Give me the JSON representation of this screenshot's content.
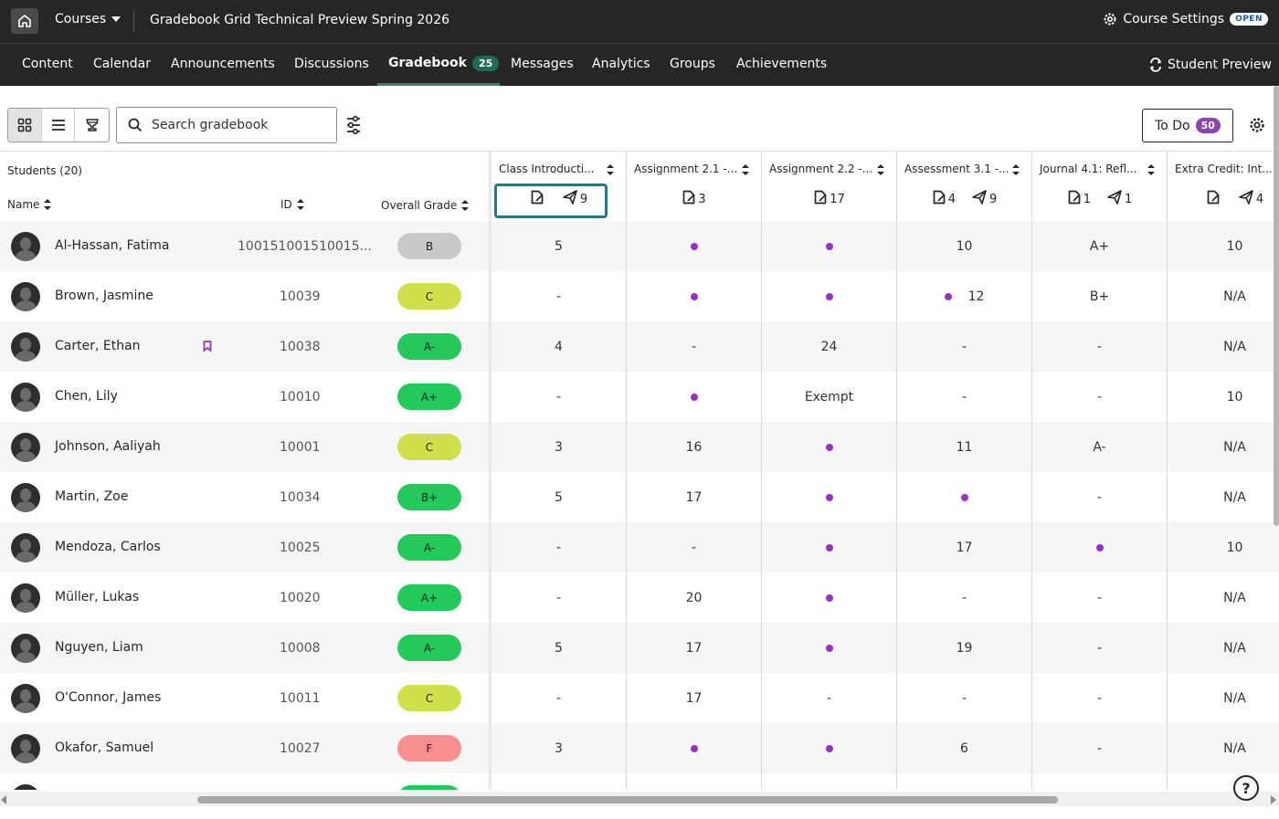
{
  "topbar": {
    "courses_label": "Courses",
    "course_title": "Gradebook Grid Technical Preview Spring 2026",
    "settings_label": "Course Settings",
    "open_badge": "OPEN"
  },
  "nav": {
    "items": [
      "Content",
      "Calendar",
      "Announcements",
      "Discussions",
      "Gradebook",
      "Messages",
      "Analytics",
      "Groups",
      "Achievements"
    ],
    "gradebook_count": "25",
    "student_preview": "Student Preview"
  },
  "toolbar": {
    "search_placeholder": "Search gradebook",
    "todo_label": "To Do",
    "todo_count": "50"
  },
  "grid": {
    "students_count": "Students (20)",
    "name_header": "Name",
    "id_header": "ID",
    "overall_header": "Overall Grade",
    "columns": [
      {
        "title": "Class Introducti...",
        "stats": [
          {
            "icon": "submission-icon",
            "count": ""
          },
          {
            "icon": "send-icon",
            "count": "9"
          }
        ]
      },
      {
        "title": "Assignment 2.1 -...",
        "stats": [
          {
            "icon": "submission-icon",
            "count": "3"
          }
        ]
      },
      {
        "title": "Assignment 2.2 -...",
        "stats": [
          {
            "icon": "submission-icon",
            "count": "17"
          }
        ]
      },
      {
        "title": "Assessment 3.1 -...",
        "stats": [
          {
            "icon": "submission-icon",
            "count": "4"
          },
          {
            "icon": "send-icon",
            "count": "9"
          }
        ]
      },
      {
        "title": "Journal 4.1: Refl...",
        "stats": [
          {
            "icon": "submission-icon",
            "count": "1"
          },
          {
            "icon": "send-icon",
            "count": "1"
          }
        ]
      },
      {
        "title": "Extra Credit: Int...",
        "stats": [
          {
            "icon": "submission-icon",
            "count": ""
          },
          {
            "icon": "send-icon",
            "count": "4"
          }
        ]
      }
    ],
    "rows": [
      {
        "name": "Al-Hassan, Fatima",
        "id": "100151001510015...",
        "grade": "B",
        "grade_color": "#c9c9c9",
        "flag": false,
        "cells": [
          "5",
          "•",
          "•",
          "10",
          "A+",
          "10"
        ]
      },
      {
        "name": "Brown, Jasmine",
        "id": "10039",
        "grade": "C",
        "grade_color": "#cfe04a",
        "flag": false,
        "cells": [
          "-",
          "•",
          "•",
          "•|12",
          "B+",
          "N/A"
        ]
      },
      {
        "name": "Carter, Ethan",
        "id": "10038",
        "grade": "A-",
        "grade_color": "#24c95b",
        "flag": true,
        "cells": [
          "4",
          "-",
          "24",
          "-",
          "-",
          "N/A"
        ]
      },
      {
        "name": "Chen, Lily",
        "id": "10010",
        "grade": "A+",
        "grade_color": "#24c95b",
        "flag": false,
        "cells": [
          "-",
          "•",
          "Exempt",
          "-",
          "-",
          "10"
        ]
      },
      {
        "name": "Johnson, Aaliyah",
        "id": "10001",
        "grade": "C",
        "grade_color": "#cfe04a",
        "flag": false,
        "cells": [
          "3",
          "16",
          "•",
          "11",
          "A-",
          "N/A"
        ]
      },
      {
        "name": "Martin, Zoe",
        "id": "10034",
        "grade": "B+",
        "grade_color": "#24c95b",
        "flag": false,
        "cells": [
          "5",
          "17",
          "•",
          "•",
          "-",
          "N/A"
        ]
      },
      {
        "name": "Mendoza, Carlos",
        "id": "10025",
        "grade": "A-",
        "grade_color": "#24c95b",
        "flag": false,
        "cells": [
          "-",
          "-",
          "•",
          "17",
          "•",
          "10"
        ]
      },
      {
        "name": "Müller, Lukas",
        "id": "10020",
        "grade": "A+",
        "grade_color": "#24c95b",
        "flag": false,
        "cells": [
          "-",
          "20",
          "•",
          "-",
          "-",
          "N/A"
        ]
      },
      {
        "name": "Nguyen, Liam",
        "id": "10008",
        "grade": "A-",
        "grade_color": "#24c95b",
        "flag": false,
        "cells": [
          "5",
          "17",
          "•",
          "19",
          "-",
          "N/A"
        ]
      },
      {
        "name": "O'Connor, James",
        "id": "10011",
        "grade": "C",
        "grade_color": "#cfe04a",
        "flag": false,
        "cells": [
          "-",
          "17",
          "-",
          "-",
          "-",
          "N/A"
        ]
      },
      {
        "name": "Okafor, Samuel",
        "id": "10027",
        "grade": "F",
        "grade_color": "#f78f8f",
        "flag": false,
        "cells": [
          "3",
          "•",
          "•",
          "6",
          "-",
          "N/A"
        ]
      }
    ]
  },
  "colors": {
    "dark_bar": "#262626",
    "accent_green": "#2e8a6f",
    "dot_purple": "#9b30c6",
    "highlight": "#1f7a8c"
  },
  "help_label": "?"
}
